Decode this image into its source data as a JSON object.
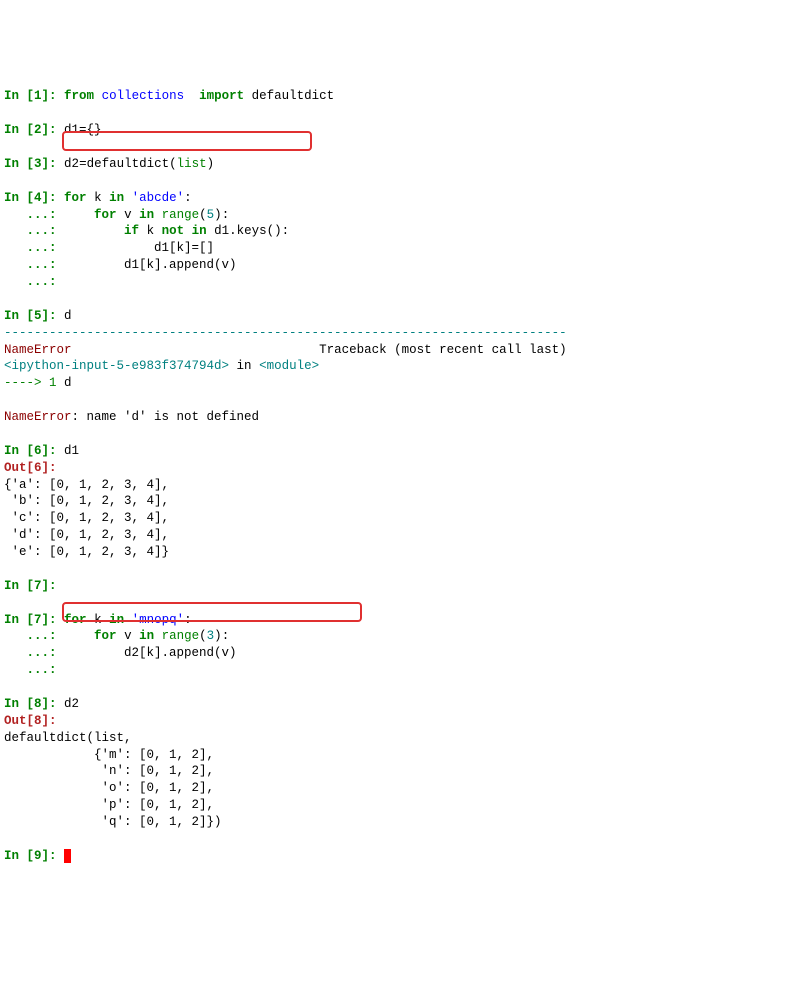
{
  "cells": {
    "in1": {
      "prompt": "In [",
      "n": "1",
      "close": "]: ",
      "code": {
        "kw1": "from",
        "mod": "collections",
        "kw2": "import",
        "name": "defaultdict"
      }
    },
    "in2": {
      "prompt": "In [",
      "n": "2",
      "close": "]: ",
      "code": "d1={}"
    },
    "in3": {
      "prompt": "In [",
      "n": "3",
      "close": "]: ",
      "code": {
        "lhs": "d2",
        "eq": "=",
        "fn": "defaultdict",
        "lp": "(",
        "arg": "list",
        "rp": ")"
      }
    },
    "in4": {
      "prompt": "In [",
      "n": "4",
      "close": "]: ",
      "l1": {
        "for": "for",
        "k": "k",
        "in": "in",
        "str": "'abcde'",
        "colon": ":"
      },
      "cont": "   ...: ",
      "l2": {
        "pad": "    ",
        "for": "for",
        "v": "v",
        "in": "in",
        "range": "range",
        "lp": "(",
        "num": "5",
        "rp": ")",
        "colon": ":"
      },
      "l3": {
        "pad": "        ",
        "if": "if",
        "k": "k",
        "not": "not",
        "in": "in",
        "d1keys": "d1.keys()",
        "colon": ":"
      },
      "l4": {
        "pad": "            ",
        "body": "d1[k]=[]"
      },
      "l5": {
        "pad": "        ",
        "body": "d1[k].append(v)"
      }
    },
    "in5": {
      "prompt": "In [",
      "n": "5",
      "close": "]: ",
      "code": "d"
    },
    "err": {
      "dashes": "---------------------------------------------------------------------------",
      "name1": "NameError",
      "tb": "Traceback (most recent call last)",
      "loc1": "<ipython-input-5-e983f374794d>",
      "in": " in ",
      "loc2": "<module>",
      "arrow": "----> 1",
      "d": " d",
      "name2": "NameError",
      "msg": ": name 'd' is not defined"
    },
    "in6": {
      "prompt": "In [",
      "n": "6",
      "close": "]: ",
      "code": "d1"
    },
    "out6": {
      "prompt": "Out[",
      "n": "6",
      "close": "]:",
      "l1": "{'a': [0, 1, 2, 3, 4],",
      "l2": " 'b': [0, 1, 2, 3, 4],",
      "l3": " 'c': [0, 1, 2, 3, 4],",
      "l4": " 'd': [0, 1, 2, 3, 4],",
      "l5": " 'e': [0, 1, 2, 3, 4]}"
    },
    "in7e": {
      "prompt": "In [",
      "n": "7",
      "close": "]: "
    },
    "in7": {
      "prompt": "In [",
      "n": "7",
      "close": "]: ",
      "l1": {
        "for": "for",
        "k": "k",
        "in": "in",
        "str": "'mnopq'",
        "colon": ":"
      },
      "cont": "   ...: ",
      "l2": {
        "pad": "    ",
        "for": "for",
        "v": "v",
        "in": "in",
        "range": "range",
        "lp": "(",
        "num": "3",
        "rp": ")",
        "colon": ":"
      },
      "l3": {
        "pad": "        ",
        "body": "d2[k].append(v)"
      }
    },
    "in8": {
      "prompt": "In [",
      "n": "8",
      "close": "]: ",
      "code": "d2"
    },
    "out8": {
      "prompt": "Out[",
      "n": "8",
      "close": "]:",
      "l1": "defaultdict(list,",
      "l2": "            {'m': [0, 1, 2],",
      "l3": "             'n': [0, 1, 2],",
      "l4": "             'o': [0, 1, 2],",
      "l5": "             'p': [0, 1, 2],",
      "l6": "             'q': [0, 1, 2]})"
    },
    "in9": {
      "prompt": "In [",
      "n": "9",
      "close": "]: "
    }
  }
}
